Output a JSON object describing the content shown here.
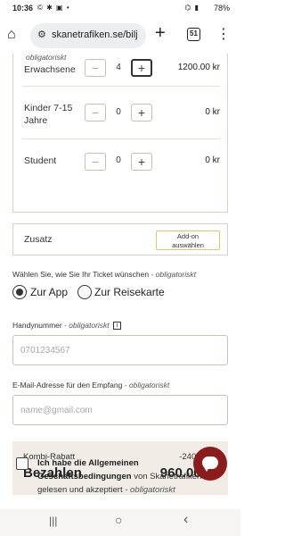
{
  "status_bar": {
    "time": "10:36",
    "left_icons": "© ✱ ▣ •",
    "signal": "⌬ ▮",
    "battery": "78%"
  },
  "browser": {
    "url": "skanetrafiken.se/bilj",
    "tabs_count": "51"
  },
  "ticket_card": {
    "top_note": "obligatoriskt",
    "rows": [
      {
        "label": "Erwachsene",
        "count": "4",
        "price": "1200.00 kr",
        "minus": "−",
        "plus": "+"
      },
      {
        "label": "Kinder 7-15 Jahre",
        "count": "0",
        "price": "0 kr",
        "minus": "−",
        "plus": "+"
      },
      {
        "label": "Student",
        "count": "0",
        "price": "0 kr",
        "minus": "−",
        "plus": "+"
      }
    ]
  },
  "zusatz": {
    "label": "Zusatz",
    "button_line1": "Add-on",
    "button_line2": "auswählen"
  },
  "ticket_type": {
    "question": "Wählen Sie, wie Sie Ihr Ticket wünschen",
    "required": " - obligatoriskt",
    "options": [
      "Zur App",
      "Zur Reisekarte"
    ],
    "selected": "Zur App"
  },
  "phone": {
    "label": "Handynummer",
    "required": " - obligatoriskt",
    "info": "i",
    "placeholder": "0701234567"
  },
  "email": {
    "label": "E-Mail-Adresse für den Empfang",
    "required": " - obligatoriskt",
    "placeholder": "name@gmail.com"
  },
  "summary": {
    "discount_label": "Kombi-Rabatt",
    "discount_value": "-240.00 kr",
    "pay_label": "Bezahlen",
    "pay_value": "960.00 kr"
  },
  "terms": {
    "prefix": "Ich habe die Allgemeinen Geschäftsbedingungen",
    "middle": " von Skånetrafiken gelesen und akzeptiert",
    "required": " - obligatoriskt"
  },
  "nav": {
    "recents": "|||",
    "home": "○",
    "back": "‹"
  },
  "colors": {
    "chat_fab": "#8c1c1c",
    "addon_border": "#e0c96a",
    "summary_bg": "#f1ede6"
  }
}
